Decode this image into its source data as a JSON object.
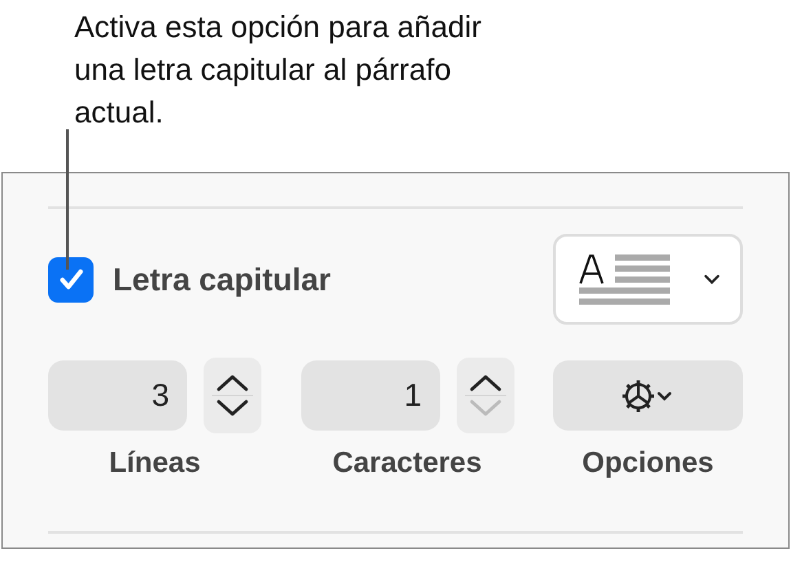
{
  "callout": {
    "text": "Activa esta opción para añadir una letra capitular al párrafo actual."
  },
  "drop_cap": {
    "label": "Letra capitular",
    "checked": true
  },
  "fields": [
    {
      "value": "3",
      "label": "Líneas",
      "up_disabled": false,
      "down_disabled": false
    },
    {
      "value": "1",
      "label": "Caracteres",
      "up_disabled": false,
      "down_disabled": true
    }
  ],
  "options": {
    "label": "Opciones"
  }
}
